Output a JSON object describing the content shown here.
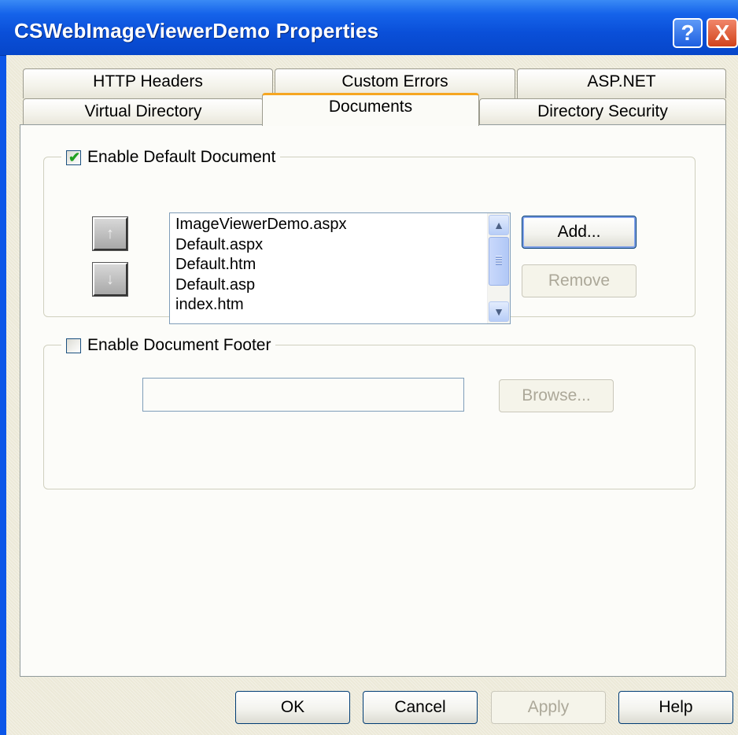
{
  "window": {
    "title": "CSWebImageViewerDemo Properties"
  },
  "titlebar_buttons": {
    "help": "?",
    "close": "X"
  },
  "tabs_row_back": [
    "HTTP Headers",
    "Custom Errors",
    "ASP.NET"
  ],
  "tabs_row_front": [
    "Virtual Directory",
    "Documents",
    "Directory Security"
  ],
  "active_tab": "Documents",
  "default_document": {
    "label": "Enable Default Document",
    "checked": true,
    "move_up_glyph": "↑",
    "move_down_glyph": "↓",
    "documents": [
      "ImageViewerDemo.aspx",
      "Default.aspx",
      "Default.htm",
      "Default.asp",
      "index.htm"
    ],
    "add_label": "Add...",
    "remove_label": "Remove"
  },
  "document_footer": {
    "label": "Enable Document Footer",
    "checked": false,
    "path_value": "",
    "browse_label": "Browse..."
  },
  "footer_buttons": {
    "ok": "OK",
    "cancel": "Cancel",
    "apply": "Apply",
    "help": "Help"
  },
  "colors": {
    "titlebar": "#0a4fd8",
    "active_tab_accent": "#f6a621",
    "dialog_face": "#ece9d8"
  }
}
